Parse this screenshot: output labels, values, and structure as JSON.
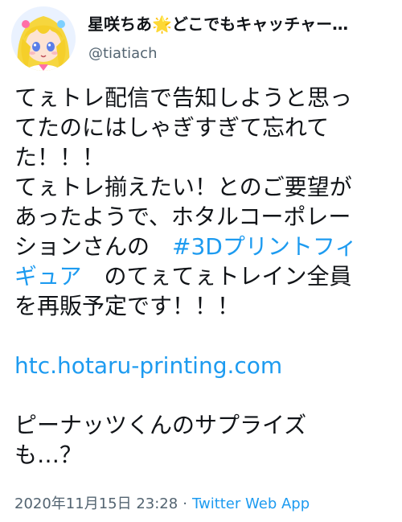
{
  "author": {
    "display_name": "星咲ちあ",
    "star_emoji": "🌟",
    "display_name_suffix": "どこでもキャッチャー…",
    "handle": "@tiatiach"
  },
  "tweet": {
    "lines": [
      "てぇトレ配信で告知しようと思っ",
      "てたのにはしゃぎすぎて忘れて",
      "た！！！",
      "てぇトレ揃えたい！とのご要望が",
      "あったようで、ホタルコーポレー"
    ],
    "line6_text": "ションさんの　",
    "hashtag_part1": "#3Dプリントフィ",
    "hashtag_part2": "ギュア",
    "line7_text": "　のてぇてぇトレイン全員",
    "line8": "を再販予定です！！！",
    "link": "htc.hotaru-printing.com",
    "line9": "ピーナッツくんのサプライズ",
    "line10": "も…？"
  },
  "meta": {
    "date_time": "2020年11月15日 23:28",
    "separator": "·",
    "source": "Twitter Web App"
  },
  "colors": {
    "link": "#1d9bf0",
    "secondary_text": "#536471",
    "primary_text": "#111418"
  }
}
